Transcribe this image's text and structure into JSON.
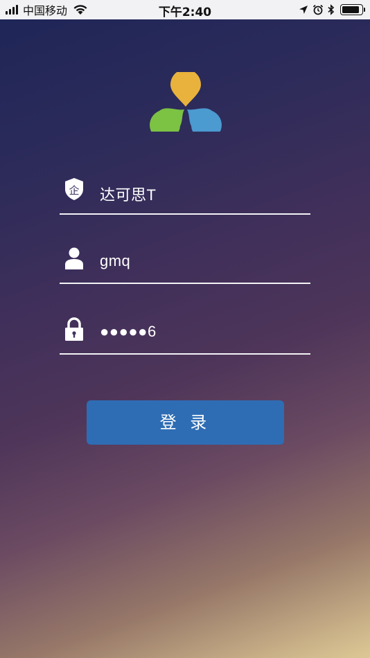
{
  "status_bar": {
    "carrier": "中国移动",
    "time": "下午2:40",
    "icons": [
      "signal-icon",
      "wifi-icon",
      "location-icon",
      "alarm-icon",
      "bluetooth-icon",
      "battery-icon"
    ],
    "battery_level": 0.9
  },
  "logo": {
    "colors": {
      "top": "#e8b23c",
      "left": "#7cc243",
      "right": "#4b9ad0"
    }
  },
  "form": {
    "company": {
      "icon": "shield-icon",
      "icon_text": "企",
      "value": "达可思T"
    },
    "username": {
      "icon": "user-icon",
      "value": "gmq"
    },
    "password": {
      "icon": "lock-icon",
      "value": "●●●●●6"
    }
  },
  "login_button": {
    "label": "登 录",
    "color": "#2e6db4"
  }
}
